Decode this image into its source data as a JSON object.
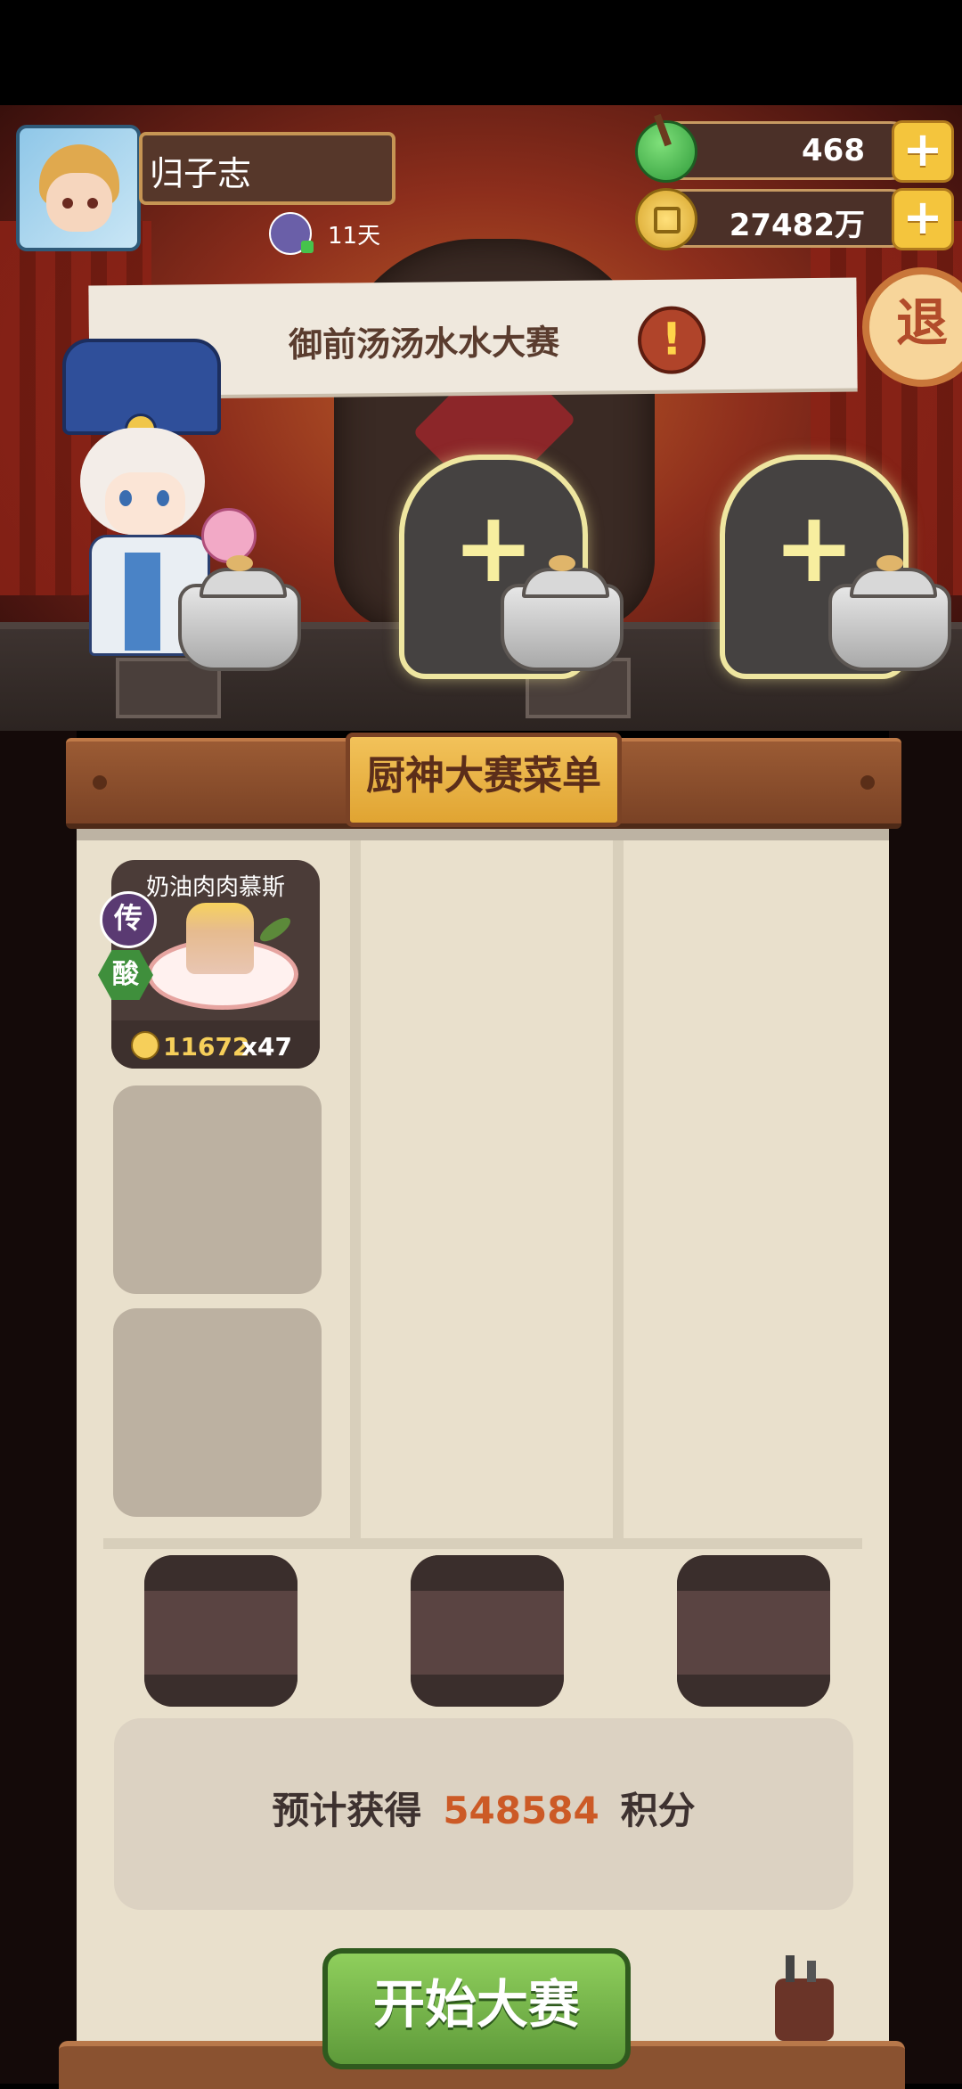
{
  "player": {
    "name": "归子志",
    "days": "11天"
  },
  "resources": {
    "jade": "468",
    "coins": "27482万"
  },
  "buttons": {
    "exit": "退",
    "start": "开始大赛"
  },
  "event": {
    "title": "御前汤汤水水大赛",
    "alert_glyph": "!"
  },
  "menu": {
    "title": "厨神大赛菜单",
    "dish": {
      "name": "奶油肉肉慕斯",
      "rarity": "传",
      "flavor": "酸",
      "price": "11672",
      "quantity": "x47"
    }
  },
  "estimate": {
    "prefix": "预计获得",
    "value": "548584",
    "suffix": "积分"
  },
  "colors": {
    "accent_gold": "#f4c53d",
    "points_orange": "#cc5a26",
    "start_green": "#6aa842"
  }
}
